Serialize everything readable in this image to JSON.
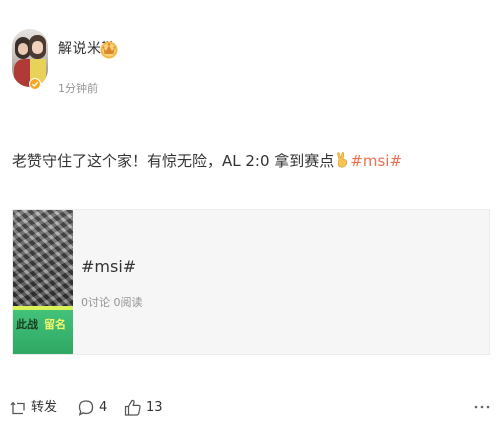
{
  "author": {
    "name": "解说米勒",
    "time": "1分钟前"
  },
  "post": {
    "text_before": "老赞守住了这个家！有惊无险，AL 2:0 拿到赛点",
    "emoji": "victory-hand-emoji",
    "hashtag": "#msi#"
  },
  "card": {
    "thumb_text_left": "此战",
    "thumb_text_right": "留名",
    "title": "#msi#",
    "meta": "0讨论 0阅读"
  },
  "actions": {
    "repost_label": "转发",
    "comment_count": "4",
    "like_count": "13"
  },
  "colors": {
    "hashtag": "#eb7350",
    "text": "#333333",
    "muted": "#939393",
    "card_bg": "#f6f6f6",
    "verify_orange": "#f5a623"
  }
}
